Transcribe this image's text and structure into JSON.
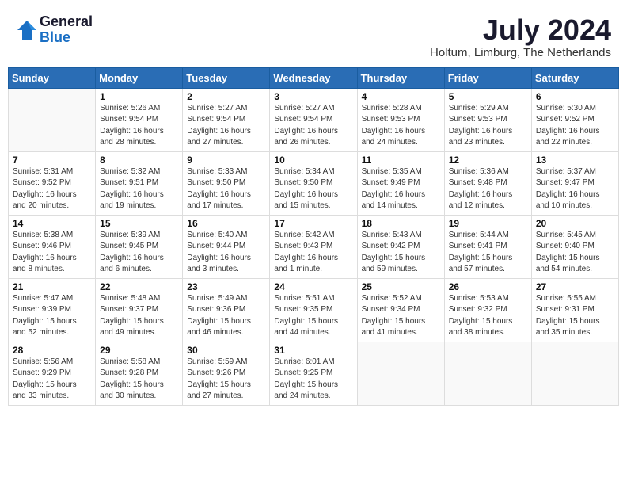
{
  "header": {
    "logo_general": "General",
    "logo_blue": "Blue",
    "month_year": "July 2024",
    "location": "Holtum, Limburg, The Netherlands"
  },
  "days_of_week": [
    "Sunday",
    "Monday",
    "Tuesday",
    "Wednesday",
    "Thursday",
    "Friday",
    "Saturday"
  ],
  "weeks": [
    [
      {
        "day": "",
        "info": ""
      },
      {
        "day": "1",
        "info": "Sunrise: 5:26 AM\nSunset: 9:54 PM\nDaylight: 16 hours\nand 28 minutes."
      },
      {
        "day": "2",
        "info": "Sunrise: 5:27 AM\nSunset: 9:54 PM\nDaylight: 16 hours\nand 27 minutes."
      },
      {
        "day": "3",
        "info": "Sunrise: 5:27 AM\nSunset: 9:54 PM\nDaylight: 16 hours\nand 26 minutes."
      },
      {
        "day": "4",
        "info": "Sunrise: 5:28 AM\nSunset: 9:53 PM\nDaylight: 16 hours\nand 24 minutes."
      },
      {
        "day": "5",
        "info": "Sunrise: 5:29 AM\nSunset: 9:53 PM\nDaylight: 16 hours\nand 23 minutes."
      },
      {
        "day": "6",
        "info": "Sunrise: 5:30 AM\nSunset: 9:52 PM\nDaylight: 16 hours\nand 22 minutes."
      }
    ],
    [
      {
        "day": "7",
        "info": "Sunrise: 5:31 AM\nSunset: 9:52 PM\nDaylight: 16 hours\nand 20 minutes."
      },
      {
        "day": "8",
        "info": "Sunrise: 5:32 AM\nSunset: 9:51 PM\nDaylight: 16 hours\nand 19 minutes."
      },
      {
        "day": "9",
        "info": "Sunrise: 5:33 AM\nSunset: 9:50 PM\nDaylight: 16 hours\nand 17 minutes."
      },
      {
        "day": "10",
        "info": "Sunrise: 5:34 AM\nSunset: 9:50 PM\nDaylight: 16 hours\nand 15 minutes."
      },
      {
        "day": "11",
        "info": "Sunrise: 5:35 AM\nSunset: 9:49 PM\nDaylight: 16 hours\nand 14 minutes."
      },
      {
        "day": "12",
        "info": "Sunrise: 5:36 AM\nSunset: 9:48 PM\nDaylight: 16 hours\nand 12 minutes."
      },
      {
        "day": "13",
        "info": "Sunrise: 5:37 AM\nSunset: 9:47 PM\nDaylight: 16 hours\nand 10 minutes."
      }
    ],
    [
      {
        "day": "14",
        "info": "Sunrise: 5:38 AM\nSunset: 9:46 PM\nDaylight: 16 hours\nand 8 minutes."
      },
      {
        "day": "15",
        "info": "Sunrise: 5:39 AM\nSunset: 9:45 PM\nDaylight: 16 hours\nand 6 minutes."
      },
      {
        "day": "16",
        "info": "Sunrise: 5:40 AM\nSunset: 9:44 PM\nDaylight: 16 hours\nand 3 minutes."
      },
      {
        "day": "17",
        "info": "Sunrise: 5:42 AM\nSunset: 9:43 PM\nDaylight: 16 hours\nand 1 minute."
      },
      {
        "day": "18",
        "info": "Sunrise: 5:43 AM\nSunset: 9:42 PM\nDaylight: 15 hours\nand 59 minutes."
      },
      {
        "day": "19",
        "info": "Sunrise: 5:44 AM\nSunset: 9:41 PM\nDaylight: 15 hours\nand 57 minutes."
      },
      {
        "day": "20",
        "info": "Sunrise: 5:45 AM\nSunset: 9:40 PM\nDaylight: 15 hours\nand 54 minutes."
      }
    ],
    [
      {
        "day": "21",
        "info": "Sunrise: 5:47 AM\nSunset: 9:39 PM\nDaylight: 15 hours\nand 52 minutes."
      },
      {
        "day": "22",
        "info": "Sunrise: 5:48 AM\nSunset: 9:37 PM\nDaylight: 15 hours\nand 49 minutes."
      },
      {
        "day": "23",
        "info": "Sunrise: 5:49 AM\nSunset: 9:36 PM\nDaylight: 15 hours\nand 46 minutes."
      },
      {
        "day": "24",
        "info": "Sunrise: 5:51 AM\nSunset: 9:35 PM\nDaylight: 15 hours\nand 44 minutes."
      },
      {
        "day": "25",
        "info": "Sunrise: 5:52 AM\nSunset: 9:34 PM\nDaylight: 15 hours\nand 41 minutes."
      },
      {
        "day": "26",
        "info": "Sunrise: 5:53 AM\nSunset: 9:32 PM\nDaylight: 15 hours\nand 38 minutes."
      },
      {
        "day": "27",
        "info": "Sunrise: 5:55 AM\nSunset: 9:31 PM\nDaylight: 15 hours\nand 35 minutes."
      }
    ],
    [
      {
        "day": "28",
        "info": "Sunrise: 5:56 AM\nSunset: 9:29 PM\nDaylight: 15 hours\nand 33 minutes."
      },
      {
        "day": "29",
        "info": "Sunrise: 5:58 AM\nSunset: 9:28 PM\nDaylight: 15 hours\nand 30 minutes."
      },
      {
        "day": "30",
        "info": "Sunrise: 5:59 AM\nSunset: 9:26 PM\nDaylight: 15 hours\nand 27 minutes."
      },
      {
        "day": "31",
        "info": "Sunrise: 6:01 AM\nSunset: 9:25 PM\nDaylight: 15 hours\nand 24 minutes."
      },
      {
        "day": "",
        "info": ""
      },
      {
        "day": "",
        "info": ""
      },
      {
        "day": "",
        "info": ""
      }
    ]
  ]
}
